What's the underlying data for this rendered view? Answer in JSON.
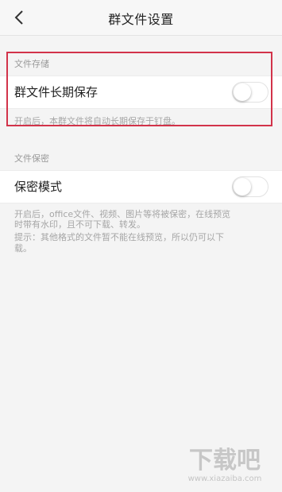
{
  "header": {
    "title": "群文件设置"
  },
  "storage_section": {
    "title": "文件存储",
    "row_label": "群文件长期保存",
    "toggle_on": false,
    "hint": "开启后，本群文件将自动长期保存于钉盘。"
  },
  "secret_section": {
    "title": "文件保密",
    "row_label": "保密模式",
    "toggle_on": false,
    "hint_lines": [
      "开启后，office文件、视频、图片等将被保密，在线预览",
      "时带有水印，且不可下载、转发。",
      "提示：其他格式的文件暂不能在线预览，所以仍可以下",
      "载。"
    ]
  },
  "watermark": {
    "brand": "下载吧",
    "url": "www.xiazaiba.com"
  },
  "colors": {
    "highlight": "#d2334a",
    "hint_text": "#a6a6a6",
    "background": "#f4f4f4"
  }
}
